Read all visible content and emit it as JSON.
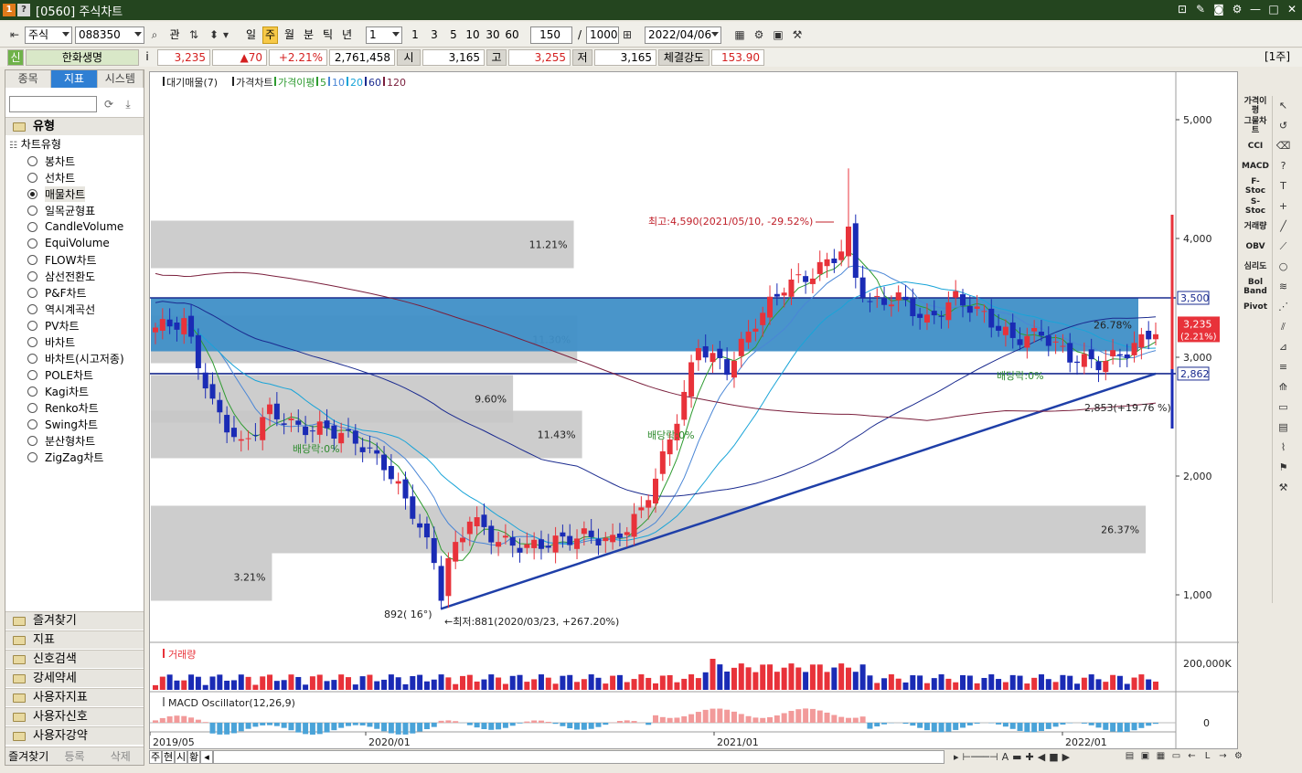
{
  "window": {
    "badge1": "1",
    "badge2": "?",
    "title": "[0560] 주식차트"
  },
  "toolbar": {
    "market": "주식",
    "code": "088350",
    "btn_gwan": "관",
    "periods": [
      "일",
      "주",
      "월",
      "분",
      "틱",
      "년"
    ],
    "active_period": "주",
    "unit_value": "1",
    "quick_units": [
      "1",
      "3",
      "5",
      "10",
      "30",
      "60"
    ],
    "count_value": "150",
    "slash": "/",
    "max_value": "1000",
    "date": "2022/04/06"
  },
  "quote": {
    "shin": "신",
    "name": "한화생명",
    "info": "i",
    "price": "3,235",
    "change": "▲70",
    "change_pct": "+2.21%",
    "volume": "2,761,458",
    "open_label": "시",
    "open": "3,165",
    "high_label": "고",
    "high": "3,255",
    "low_label": "저",
    "low": "3,165",
    "strength_label": "체결강도",
    "strength": "153.90",
    "period_tag": "[1주]"
  },
  "left_panel": {
    "tabs": [
      "종목",
      "지표",
      "시스템"
    ],
    "active_tab": "지표",
    "type_header": "유형",
    "tree_root": "차트유형",
    "chart_types": [
      "봉차트",
      "선차트",
      "매물차트",
      "일목균형표",
      "CandleVolume",
      "EquiVolume",
      "FLOW차트",
      "삼선전환도",
      "P&F차트",
      "역시계곡선",
      "PV차트",
      "바차트",
      "바차트(시고저종)",
      "POLE차트",
      "Kagi차트",
      "Renko차트",
      "Swing차트",
      "분산형차트",
      "ZigZag차트"
    ],
    "selected_type": "매물차트",
    "sections": [
      "즐겨찾기",
      "지표",
      "신호검색",
      "강세약세",
      "사용자지표",
      "사용자신호",
      "사용자강약"
    ],
    "footer": [
      "즐겨찾기",
      "등록",
      "삭제"
    ]
  },
  "chart": {
    "legend_main": [
      "대기매물(7)",
      "가격차트",
      "가격이평",
      "5",
      "10",
      "20",
      "60",
      "120"
    ],
    "legend_volume": "거래량",
    "legend_macd": "MACD Oscillator(12,26,9)",
    "price_axis": [
      "5,000",
      "4,000",
      "3,000",
      "2,000",
      "1,000"
    ],
    "price_tag_upper": "3,500",
    "price_tag_lower": "2,862",
    "current_tag": "3,235",
    "current_tag_pct": "(2.21%)",
    "volume_axis": "200,000K",
    "macd_axis": "0",
    "date_axis": [
      "2019/05",
      "2020/01",
      "2021/01",
      "2022/01"
    ],
    "annotations": {
      "high": "최고:4,590(2021/05/10, -29.52%)",
      "low": "←최저:881(2020/03/23, +267.20%)",
      "angle": "892( 16°)",
      "div1": "배당락:0%",
      "div2": "배당락:0%",
      "div3": "배당락:0%",
      "trend": "2,853(+19.76 %)"
    }
  },
  "chart_data": {
    "type": "bar",
    "title": "",
    "xlabel": "",
    "ylabel": "",
    "categories": [
      "11.21%",
      "11.30%",
      "9.60%",
      "11.43%",
      "26.37%",
      "3.21%",
      "26.78%"
    ],
    "values": [
      11.21,
      11.3,
      9.6,
      11.43,
      26.37,
      3.21,
      26.78
    ],
    "price_bands": [
      [
        3750,
        4150
      ],
      [
        2950,
        3350
      ],
      [
        2450,
        2850
      ],
      [
        2150,
        2550
      ],
      [
        1350,
        1750
      ],
      [
        950,
        1350
      ],
      [
        3050,
        3500
      ]
    ],
    "ylim": [
      600,
      5400
    ],
    "grid": false,
    "price_series": {
      "name": "가격차트",
      "dates": [
        "2019/05",
        "2019/06",
        "2019/07",
        "2019/08",
        "2019/09",
        "2019/10",
        "2019/11",
        "2019/12",
        "2020/01",
        "2020/02",
        "2020/03",
        "2020/04",
        "2020/05",
        "2020/06",
        "2020/07",
        "2020/08",
        "2020/09",
        "2020/10",
        "2020/11",
        "2020/12",
        "2021/01",
        "2021/02",
        "2021/03",
        "2021/04",
        "2021/05",
        "2021/06",
        "2021/07",
        "2021/08",
        "2021/09",
        "2021/10",
        "2021/11",
        "2021/12",
        "2022/01",
        "2022/02",
        "2022/03",
        "2022/04"
      ],
      "close": [
        3250,
        3300,
        2600,
        2250,
        2550,
        2400,
        2400,
        2300,
        2100,
        1700,
        1150,
        1650,
        1450,
        1400,
        1450,
        1500,
        1450,
        1700,
        2300,
        3100,
        2900,
        3300,
        3600,
        3700,
        3900,
        3450,
        3500,
        3300,
        3500,
        3350,
        3150,
        3200,
        3000,
        2950,
        3050,
        3235
      ]
    },
    "ma_periods": [
      5,
      10,
      20,
      60,
      120
    ],
    "levels": {
      "upper": 3500,
      "lower": 2862
    },
    "extremes": {
      "high": 4590,
      "high_date": "2021/05/10",
      "low": 881,
      "low_date": "2020/03/23"
    }
  },
  "right_bar": [
    "가격이평",
    "그물차트",
    "CCI",
    "MACD",
    "F-Stoc",
    "S-Stoc",
    "거래량",
    "OBV",
    "심리도",
    "Bol Band",
    "Pivot"
  ],
  "bottom_tabs": [
    "주",
    "현",
    "시",
    "황"
  ],
  "colors": {
    "titlebar": "#24451f",
    "up": "#e8323a",
    "down": "#1a2bb5",
    "band": "#c8c8c8",
    "highlight_band": "#3f8fc7",
    "ma5": "#2e9b30",
    "ma10": "#4a86d6",
    "ma20": "#19a4d8",
    "ma60": "#1b2b8f",
    "ma120": "#7a1f3c"
  }
}
